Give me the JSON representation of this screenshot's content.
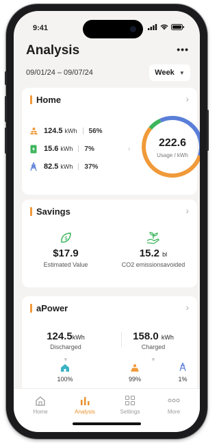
{
  "status": {
    "time": "9:41"
  },
  "header": {
    "title": "Analysis",
    "more_label": "•••"
  },
  "date_range": "09/01/24 – 09/07/24",
  "period_select": {
    "selected": "Week"
  },
  "home": {
    "title": "Home",
    "rows": [
      {
        "icon": "solar-panel-icon",
        "value": "124.5",
        "unit": "kWh",
        "percent": "56%",
        "color": "#f09a3a"
      },
      {
        "icon": "battery-icon",
        "value": "15.6",
        "unit": "kWh",
        "percent": "7%",
        "color": "#3cb55b"
      },
      {
        "icon": "grid-tower-icon",
        "value": "82.5",
        "unit": "kWh",
        "percent": "37%",
        "color": "#5a7fd8"
      }
    ],
    "total": "222.6",
    "total_label": "Usage / kWh"
  },
  "savings": {
    "title": "Savings",
    "estimated_value": "$17.9",
    "estimated_label": "Estimated Value",
    "co2_value": "15.2",
    "co2_unit": "bl",
    "co2_label": "CO2 emissionsavoided"
  },
  "apower": {
    "title": "aPower",
    "discharged_value": "124.5",
    "discharged_unit": "kWh",
    "discharged_label": "Discharged",
    "charged_value": "158.0",
    "charged_unit": "kWh",
    "charged_label": "Charged",
    "home_percent": "100%",
    "solar_percent": "99%",
    "grid_percent": "1%"
  },
  "tabs": [
    {
      "label": "Home",
      "icon": "home-icon"
    },
    {
      "label": "Analysis",
      "icon": "bar-chart-icon",
      "active": true
    },
    {
      "label": "Settings",
      "icon": "grid-squares-icon"
    },
    {
      "label": "More",
      "icon": "more-dots-icon"
    }
  ],
  "colors": {
    "accent": "#e8922c",
    "solar": "#f09a3a",
    "battery": "#3cb55b",
    "grid": "#5a7fd8"
  }
}
